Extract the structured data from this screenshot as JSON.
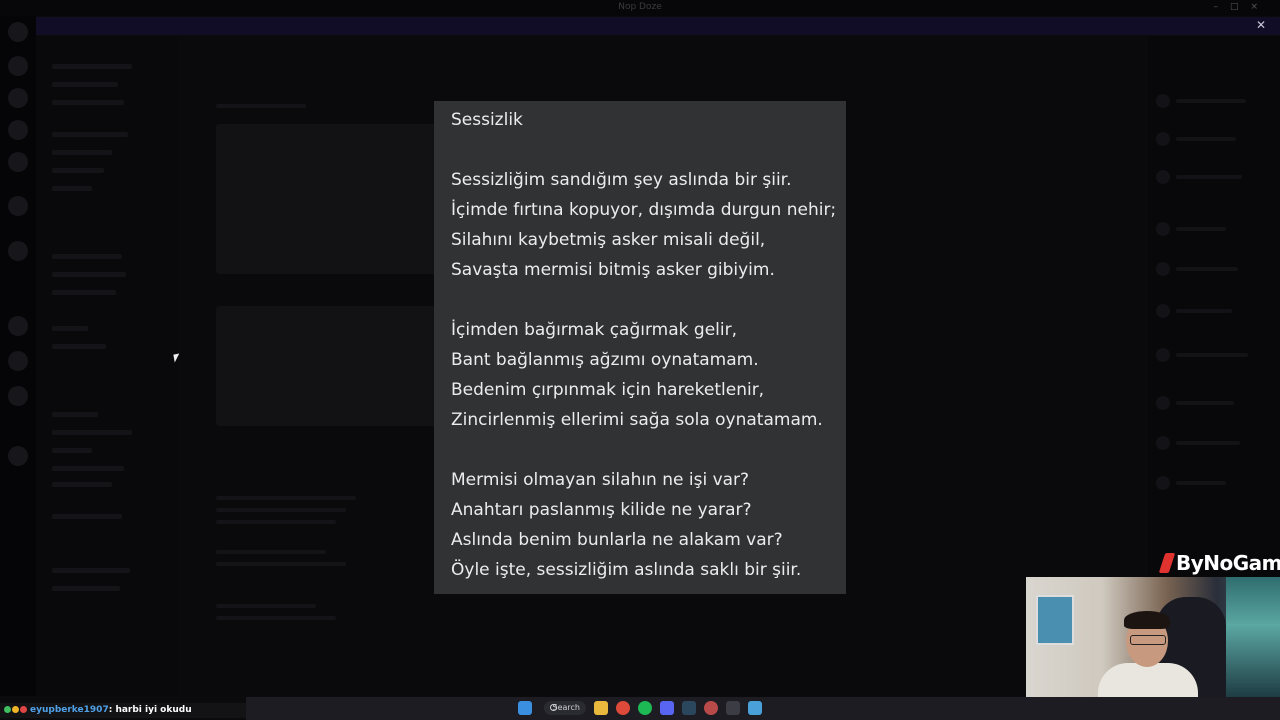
{
  "window": {
    "title": "Nop Doze",
    "controls": [
      "–",
      "□",
      "×"
    ]
  },
  "banner": {
    "text": "",
    "close_icon": "close-icon"
  },
  "poem": {
    "title": "Sessizlik",
    "stanzas": [
      [
        "Sessizliğim sandığım şey aslında bir şiir.",
        "İçimde fırtına kopuyor, dışımda durgun nehir;",
        "Silahını kaybetmiş asker misali değil,",
        "Savaşta mermisi bitmiş asker gibiyim."
      ],
      [
        "İçimden bağırmak çağırmak gelir,",
        "Bant bağlanmış ağzımı oynatamam.",
        "Bedenim çırpınmak için hareketlenir,",
        "Zincirlenmiş ellerimi sağa sola oynatamam."
      ],
      [
        "Mermisi olmayan silahın ne işi var?",
        "Anahtarı paslanmış kilide ne yarar?",
        "Aslında benim bunlarla ne alakam var?",
        "Öyle işte, sessizliğim aslında saklı bir şiir."
      ]
    ]
  },
  "brand": {
    "name": "ByNoGame",
    "accent": "#e03330"
  },
  "chat_message": {
    "user": "eyupberke1907",
    "separator": ": ",
    "text": "harbi iyi okudu",
    "user_color": "#4fa1e8",
    "badge_colors": [
      "#3fbf5f",
      "#f0b429",
      "#e04545"
    ]
  },
  "taskbar": {
    "search_label": "Search",
    "icons": [
      "windows-start-icon",
      "search-icon",
      "file-explorer-icon",
      "chrome-icon",
      "spotify-icon",
      "discord-icon",
      "steam-icon",
      "app-icon",
      "obs-icon",
      "settings-icon"
    ]
  }
}
